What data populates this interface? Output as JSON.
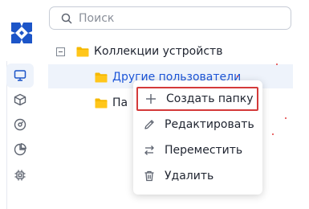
{
  "search": {
    "placeholder": "Поиск"
  },
  "sidebar": {
    "items": [
      {
        "icon": "monitor-icon",
        "active": true
      },
      {
        "icon": "cube-icon"
      },
      {
        "icon": "gauge-icon"
      },
      {
        "icon": "pie-chart-icon"
      },
      {
        "icon": "chip-icon"
      }
    ]
  },
  "tree": {
    "root": {
      "label": "Коллекции устройств"
    },
    "children": [
      {
        "label": "Другие пользователи"
      },
      {
        "label": "Па"
      }
    ]
  },
  "context_menu": {
    "items": [
      {
        "label": "Создать папку",
        "icon": "plus-icon"
      },
      {
        "label": "Редактировать",
        "icon": "pencil-icon"
      },
      {
        "label": "Переместить",
        "icon": "move-arrows-icon"
      },
      {
        "label": "Удалить",
        "icon": "trash-icon"
      }
    ]
  },
  "colors": {
    "accent": "#1d56d8",
    "selection_bg": "#eef3fb",
    "folder": "#f5b800",
    "highlight_border": "#d43a3a",
    "logo": "#1c55c8"
  }
}
